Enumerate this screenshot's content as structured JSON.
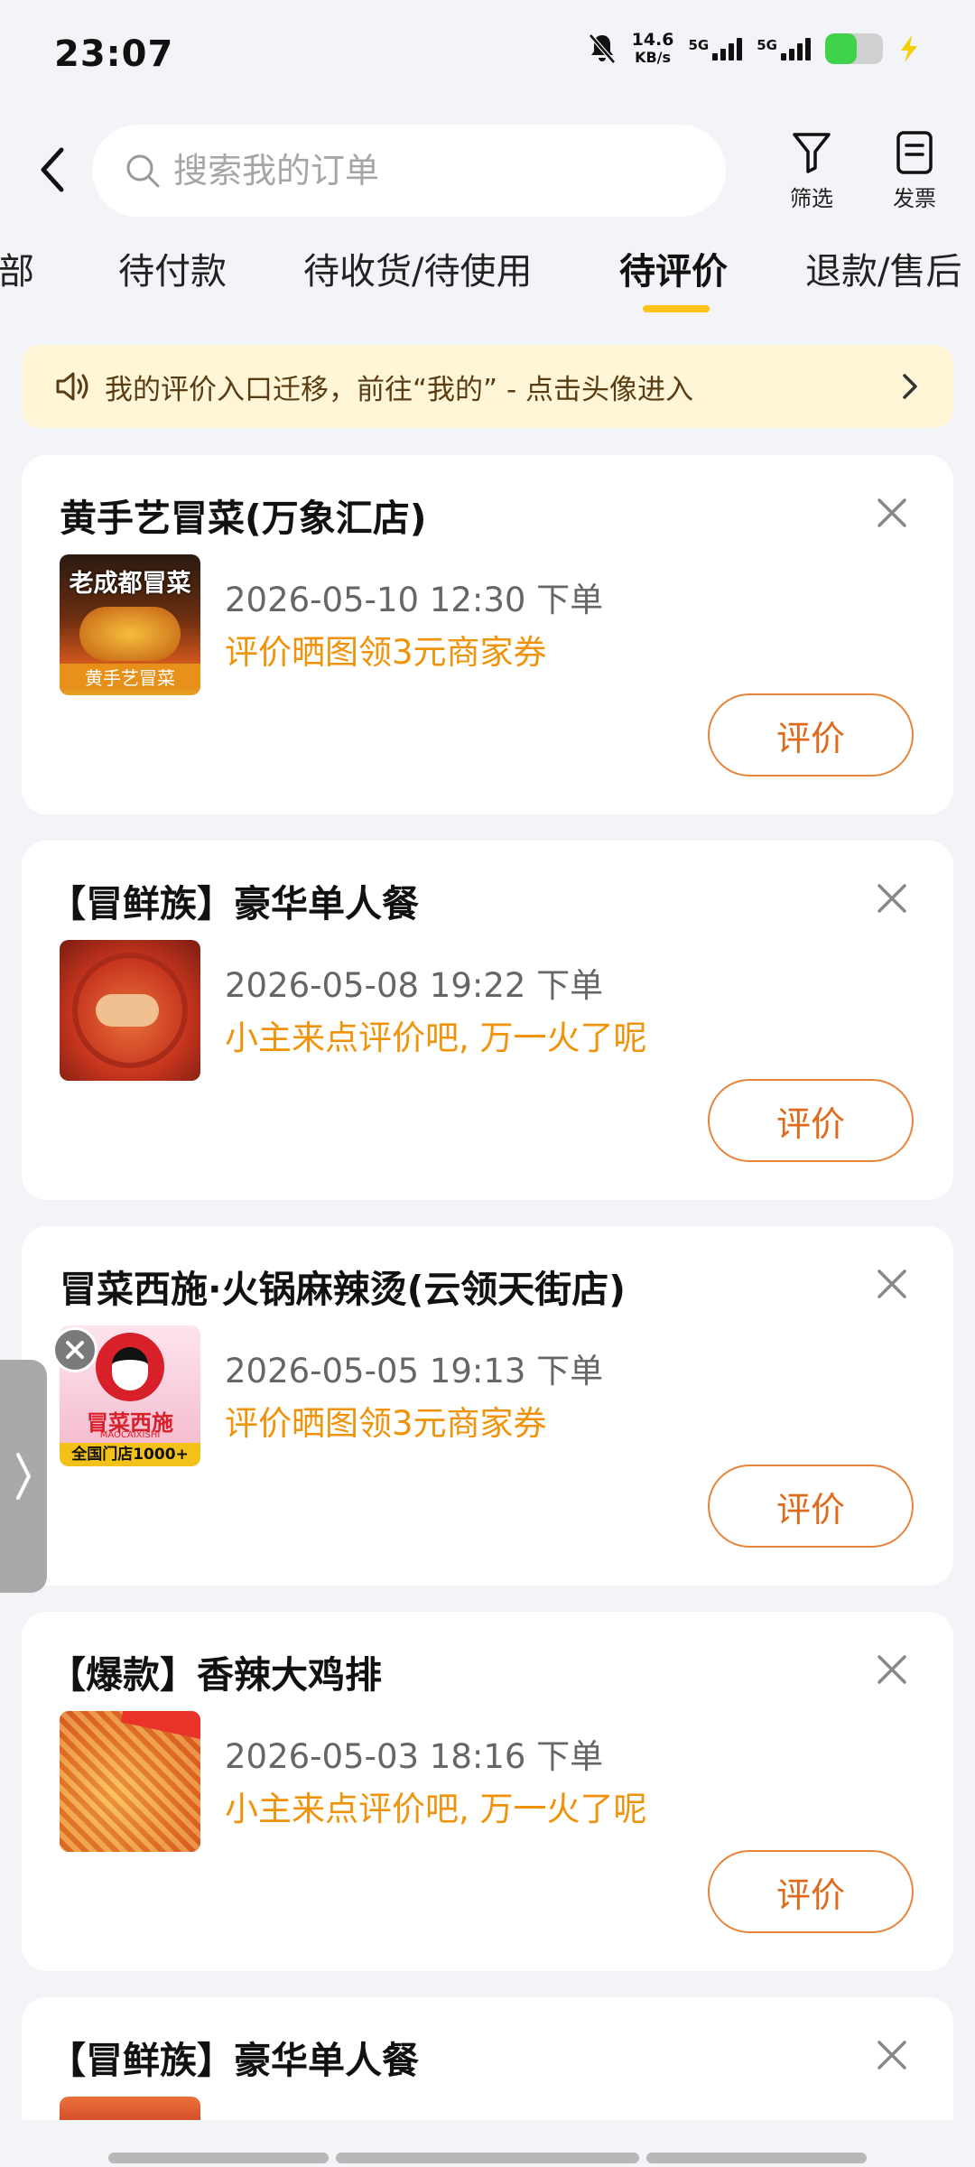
{
  "status_bar": {
    "time": "23:07",
    "net_speed_value": "14.6",
    "net_speed_unit": "KB/s",
    "sim1_label": "5G",
    "sim2_label": "5G",
    "battery_level": 0.55,
    "icons": [
      "bell-mute-icon",
      "signal-icon",
      "battery-icon",
      "charging-icon"
    ]
  },
  "header": {
    "search_placeholder": "搜索我的订单",
    "filter_label": "筛选",
    "invoice_label": "发票"
  },
  "tabs": {
    "items": [
      "全部",
      "待付款",
      "待收货/待使用",
      "待评价",
      "退款/售后"
    ],
    "active": "待评价"
  },
  "notice": {
    "text": "我的评价入口迁移，前往“我的” - 点击头像进入"
  },
  "orders": [
    {
      "title": "黄手艺冒菜(万象汇店)",
      "time": "2026-05-10 12:30 下单",
      "promo": "评价晒图领3元商家券",
      "button": "评价",
      "thumb_text_top": "老成都冒菜",
      "thumb_text_bottom": "黄手艺冒菜"
    },
    {
      "title": "【冒鲜族】豪华单人餐",
      "time": "2026-05-08 19:22 下单",
      "promo": "小主来点评价吧, 万一火了呢",
      "button": "评价"
    },
    {
      "title": "冒菜西施·火锅麻辣烫(云领天街店)",
      "time": "2026-05-05 19:13 下单",
      "promo": "评价晒图领3元商家券",
      "button": "评价",
      "thumb_text_brand": "冒菜西施",
      "thumb_text_en": "MAOCAIXISHI",
      "thumb_text_badge": "全国门店1000+"
    },
    {
      "title": "【爆款】香辣大鸡排",
      "time": "2026-05-03 18:16 下单",
      "promo": "小主来点评价吧, 万一火了呢",
      "button": "评价"
    },
    {
      "title": "【冒鲜族】豪华单人餐"
    }
  ]
}
